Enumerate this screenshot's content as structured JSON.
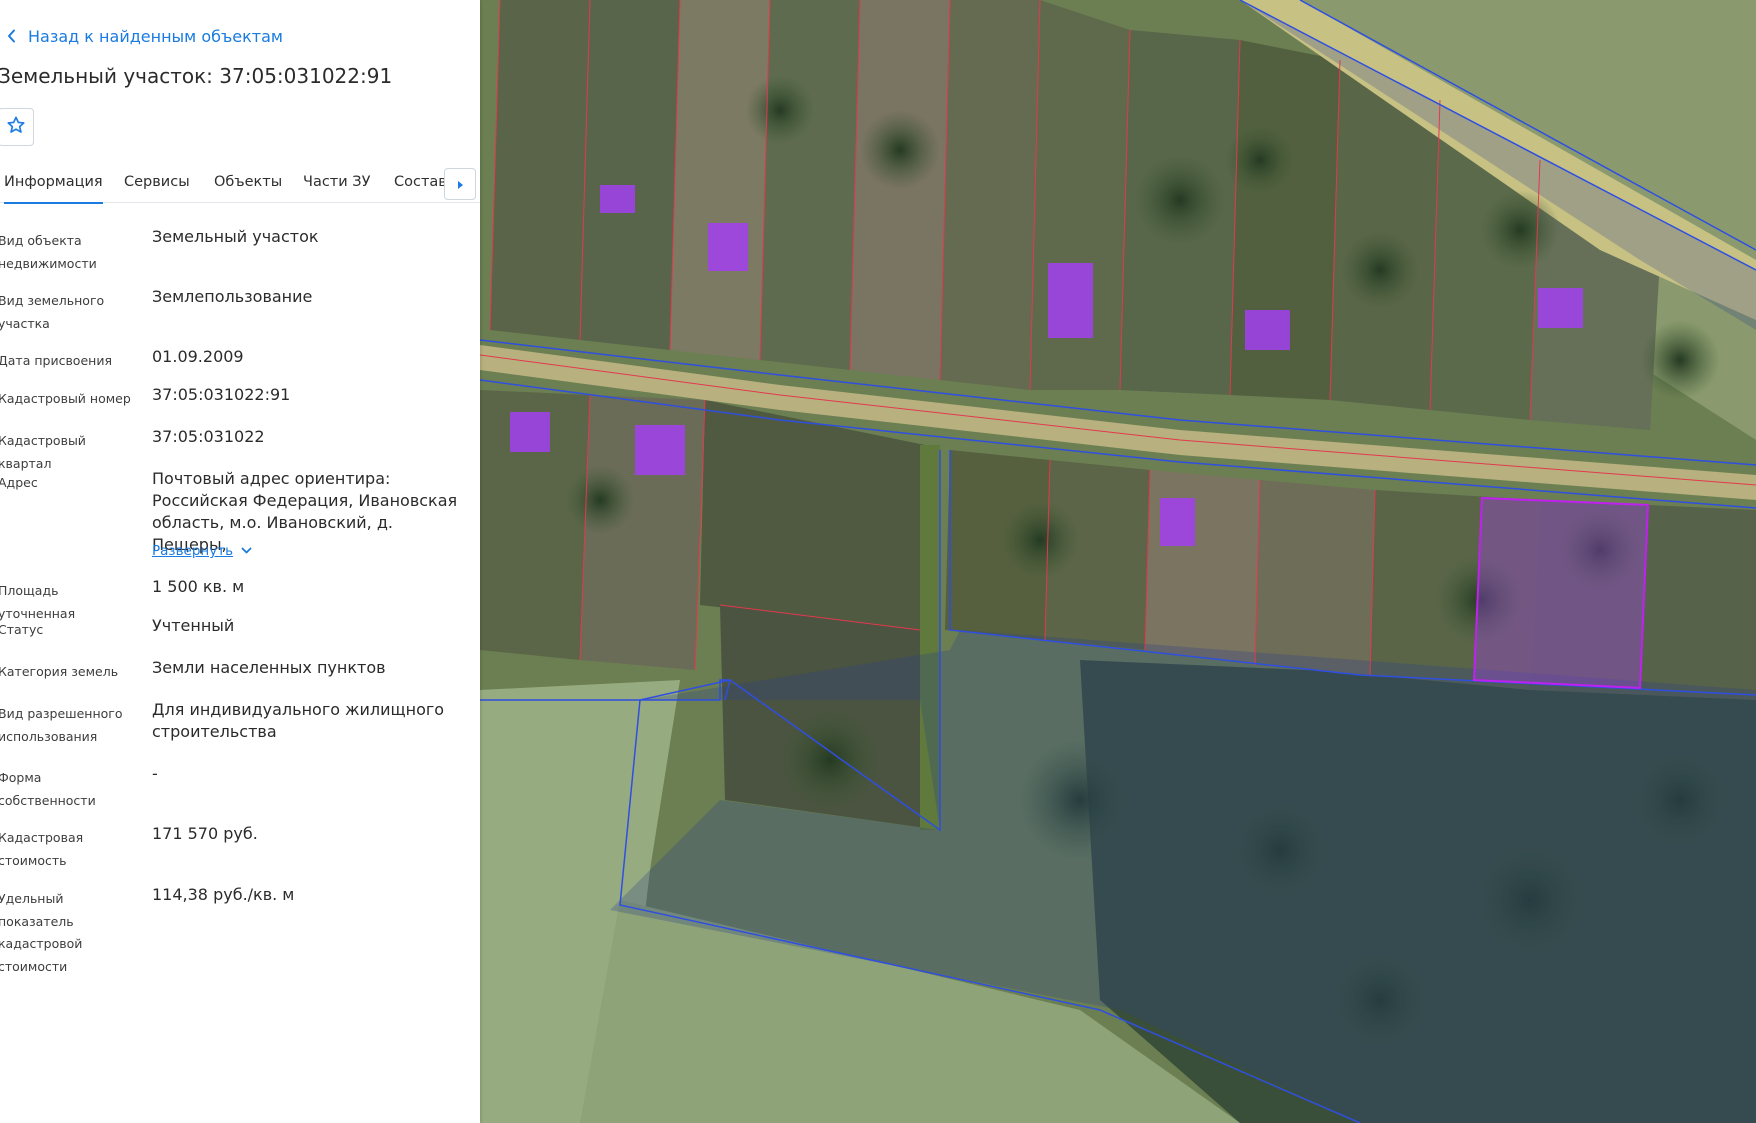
{
  "nav": {
    "back_label": "Назад к найденным объектам"
  },
  "object": {
    "title": "Земельный участок: 37:05:031022:91"
  },
  "tabs": [
    {
      "label": "Информация",
      "active": true
    },
    {
      "label": "Сервисы",
      "active": false
    },
    {
      "label": "Объекты",
      "active": false
    },
    {
      "label": "Части ЗУ",
      "active": false
    },
    {
      "label": "Состав",
      "active": false
    }
  ],
  "info": {
    "fields": [
      {
        "label": "Вид объекта недвижимости",
        "value": "Земельный участок"
      },
      {
        "label": "Вид земельного участка",
        "value": "Землепользование"
      },
      {
        "label": "Дата присвоения",
        "value": "01.09.2009"
      },
      {
        "label": "Кадастровый номер",
        "value": "37:05:031022:91"
      },
      {
        "label": "Кадастровый квартал",
        "value": "37:05:031022"
      },
      {
        "label": "Адрес",
        "value": "Почтовый адрес ориентира: Российская Федерация, Ивановская область, м.о. Ивановский, д. Пещеры,"
      },
      {
        "label": "Площадь уточненная",
        "value": "1 500 кв. м"
      },
      {
        "label": "Статус",
        "value": "Учтенный"
      },
      {
        "label": "Категория земель",
        "value": "Земли населенных пунктов"
      },
      {
        "label": "Вид разрешенного использования",
        "value": "Для индивидуального жилищного строительства"
      },
      {
        "label": "Форма собственности",
        "value": "-"
      },
      {
        "label": "Кадастровая стоимость",
        "value": "171 570 руб."
      },
      {
        "label": "Удельный показатель кадастровой стоимости",
        "value": "114,38 руб./кв. м"
      }
    ],
    "expand_label": "Развернуть"
  },
  "colors": {
    "accent": "#1b7be0",
    "building": "#a23ff0",
    "parcel_border": "#2f4fe0",
    "parcel_line": "#e3384f"
  }
}
